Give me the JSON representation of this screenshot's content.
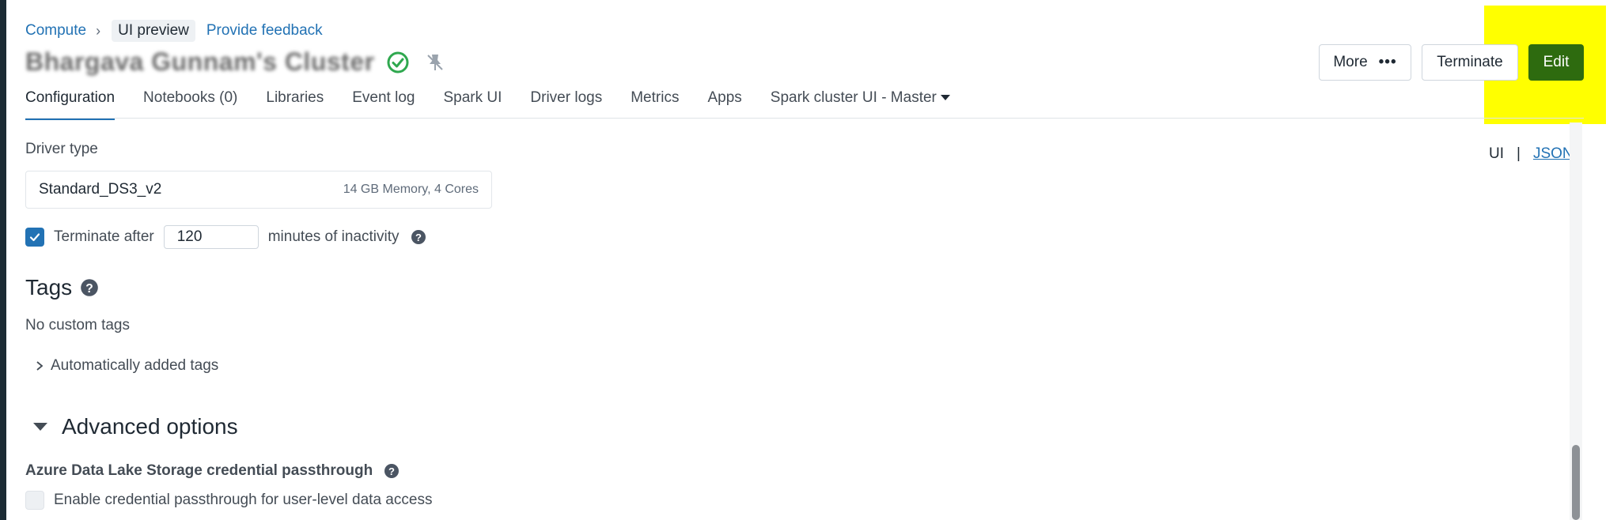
{
  "breadcrumb": {
    "compute": "Compute",
    "separator": "›",
    "ui_preview": "UI preview",
    "feedback": "Provide feedback"
  },
  "cluster": {
    "name": "Bhargava Gunnam's Cluster",
    "status_icon": "check-circle-icon",
    "pin_icon": "pin-off-icon"
  },
  "actions": {
    "more": "More",
    "more_icon": "ellipsis-icon",
    "terminate": "Terminate",
    "edit": "Edit"
  },
  "tabs": [
    {
      "label": "Configuration",
      "active": true
    },
    {
      "label": "Notebooks (0)",
      "active": false
    },
    {
      "label": "Libraries",
      "active": false
    },
    {
      "label": "Event log",
      "active": false
    },
    {
      "label": "Spark UI",
      "active": false
    },
    {
      "label": "Driver logs",
      "active": false
    },
    {
      "label": "Metrics",
      "active": false
    },
    {
      "label": "Apps",
      "active": false
    },
    {
      "label": "Spark cluster UI - Master",
      "active": false
    }
  ],
  "view_toggle": {
    "ui": "UI",
    "separator": "|",
    "json": "JSON"
  },
  "driver": {
    "label": "Driver type",
    "value": "Standard_DS3_v2",
    "spec": "14 GB Memory, 4 Cores"
  },
  "auto_terminate": {
    "checked": true,
    "label_before": "Terminate after",
    "minutes": "120",
    "label_after": "minutes of inactivity"
  },
  "tags": {
    "heading": "Tags",
    "empty": "No custom tags",
    "auto_tags": "Automatically added tags"
  },
  "advanced": {
    "heading": "Advanced options"
  },
  "adls": {
    "label": "Azure Data Lake Storage credential passthrough",
    "checkbox_label": "Enable credential passthrough for user-level data access",
    "checked": false
  },
  "colors": {
    "accent": "#2272b4",
    "edit_button": "#2e6b0f",
    "highlight": "#ffff00",
    "status_green": "#2fa84f"
  }
}
